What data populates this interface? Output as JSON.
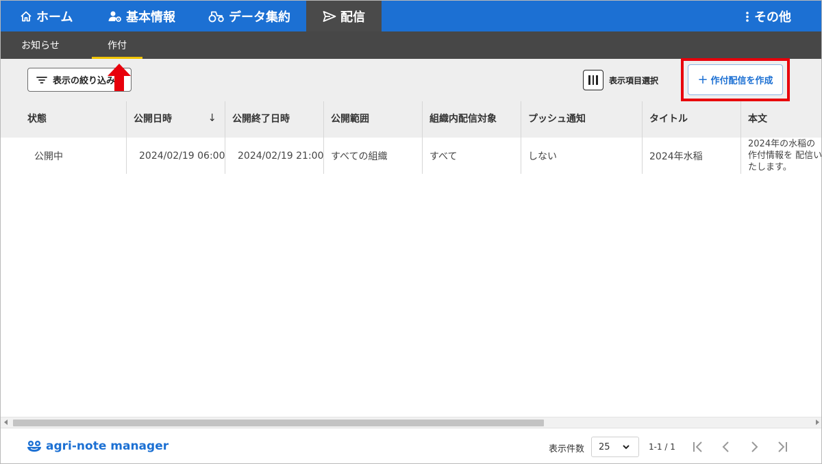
{
  "nav": {
    "home": "ホーム",
    "basic_info": "基本情報",
    "data_aggregation": "データ集約",
    "delivery": "配信",
    "more": "その他"
  },
  "subnav": {
    "notices": "お知らせ",
    "sakuzuke": "作付"
  },
  "toolbar": {
    "filter_label": "表示の絞り込み",
    "column_select_label": "表示項目選択",
    "create_label": "作付配信を作成"
  },
  "table": {
    "headers": [
      "状態",
      "公開日時",
      "公開終了日時",
      "公開範囲",
      "組織内配信対象",
      "プッシュ通知",
      "タイトル",
      "本文"
    ],
    "rows": [
      {
        "status": "公開中",
        "publish_at": "2024/02/19 06:00",
        "publish_end": "2024/02/19 21:00",
        "scope": "すべての組織",
        "target": "すべて",
        "push": "しない",
        "title": "2024年水稲",
        "body": "2024年の水稲の作付情報を 配信いたします。"
      }
    ]
  },
  "footer": {
    "brand": "agri-note manager",
    "per_page_label": "表示件数",
    "per_page_value": "25",
    "range_text": "1-1 / 1"
  },
  "colors": {
    "nav_blue": "#1c70d3",
    "subnav_dark": "#474747",
    "active_underline": "#f2c500",
    "annotation_red": "#e8000b"
  }
}
